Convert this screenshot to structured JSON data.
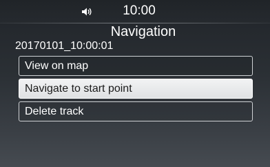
{
  "status_bar": {
    "icon": "volume-icon",
    "time": "10:00"
  },
  "screen": {
    "title": "Navigation",
    "subtitle": "20170101_10:00:01"
  },
  "menu": {
    "items": [
      {
        "label": "View on map",
        "selected": false
      },
      {
        "label": "Navigate to start point",
        "selected": true
      },
      {
        "label": "Delete track",
        "selected": false
      }
    ]
  },
  "colors": {
    "selected_bg": "#e6e8ea",
    "text": "#ffffff",
    "selected_text": "#1a1a1a",
    "border": "#d0d3d6"
  }
}
